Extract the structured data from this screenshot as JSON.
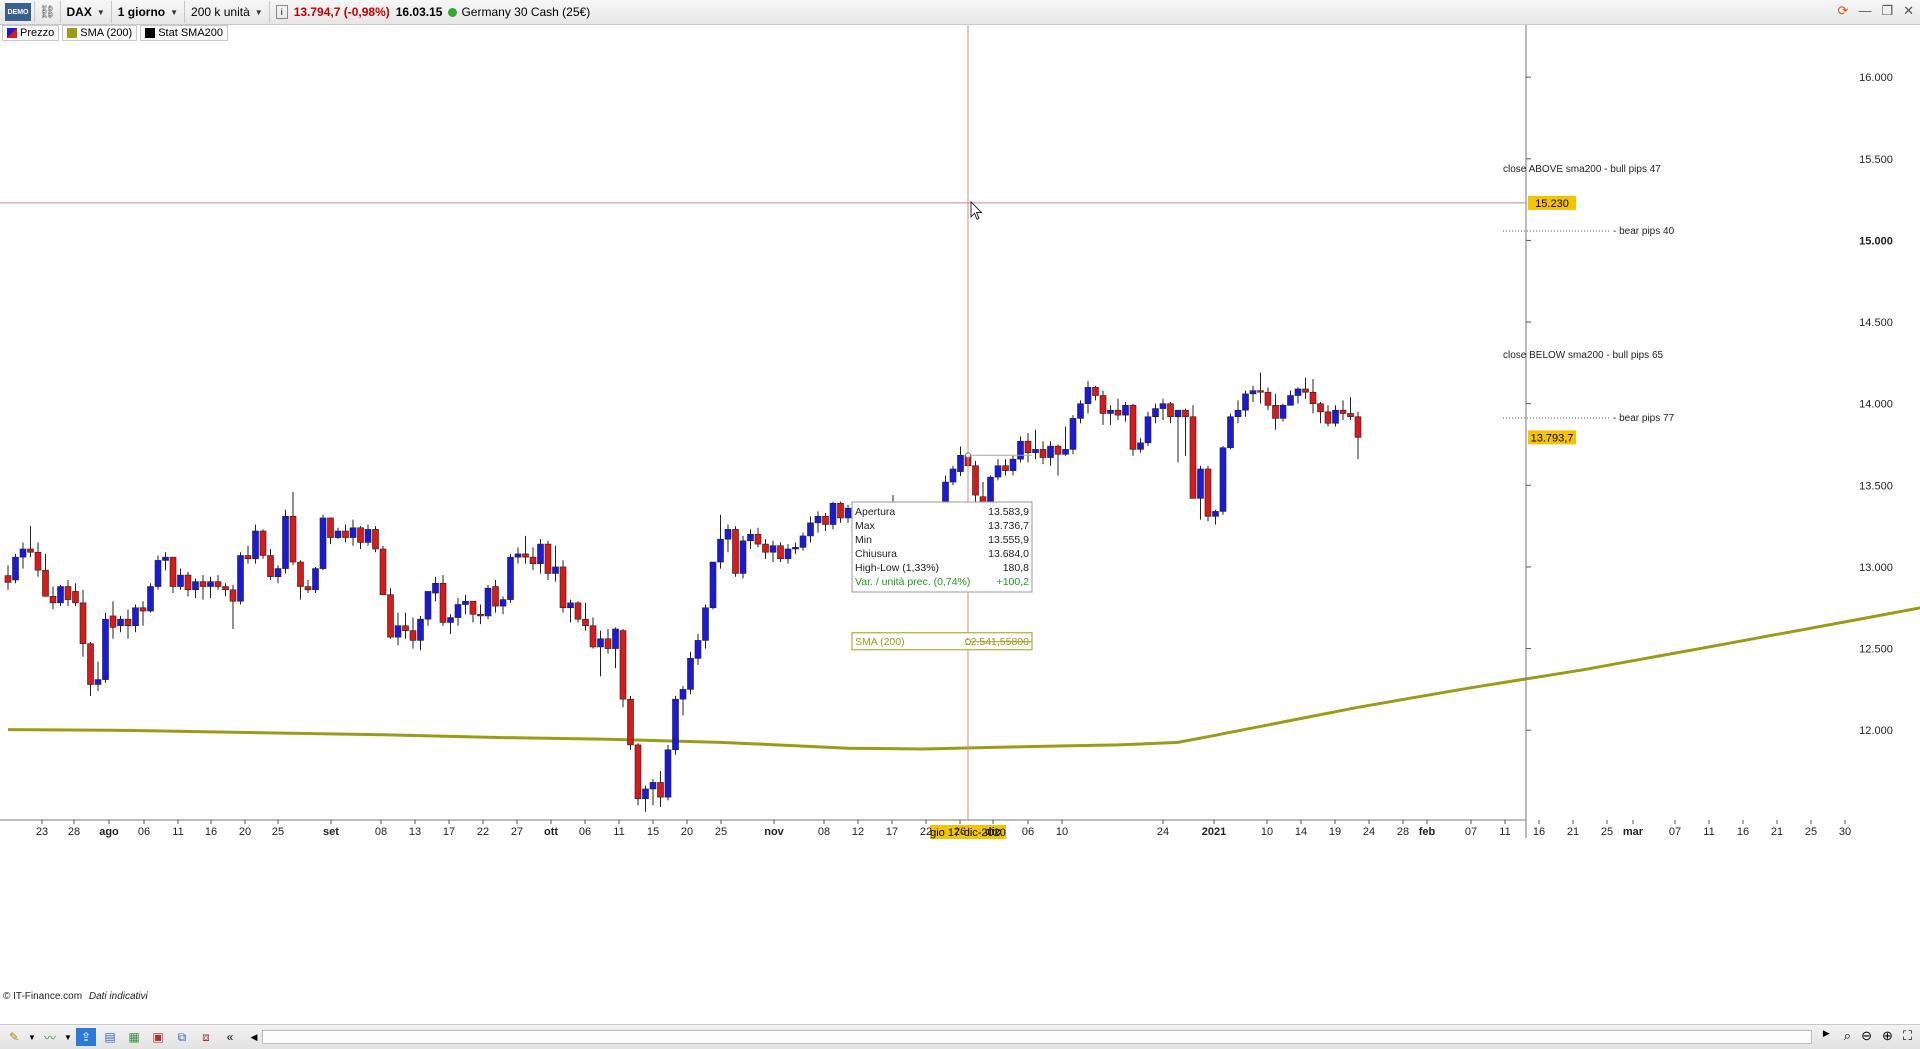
{
  "toolbar": {
    "logo": "DEMO",
    "symbol": "DAX",
    "timeframe": "1 giorno",
    "units": "200 k unità",
    "info_icon": "info-icon",
    "price": "13.794,7 (-0,98%)",
    "time": "16.03.15",
    "instrument": "Germany 30 Cash (25€)"
  },
  "legend": {
    "price": {
      "label": "Prezzo",
      "color": "#1b1bd6"
    },
    "sma": {
      "label": "SMA (200)",
      "color": "#9b9b1a"
    },
    "stat": {
      "label": "Stat SMA200",
      "color": "#000000"
    }
  },
  "tooltip": {
    "rows": [
      {
        "label": "Apertura",
        "value": "13.583,9"
      },
      {
        "label": "Max",
        "value": "13.736,7"
      },
      {
        "label": "Min",
        "value": "13.555,9"
      },
      {
        "label": "Chiusura",
        "value": "13.684,0"
      },
      {
        "label": "High-Low (1,33%)",
        "value": "180,8"
      },
      {
        "label": "Var. / unità prec. (0,74%)",
        "value": "+100,2"
      }
    ]
  },
  "sma_tooltip": {
    "label": "SMA (200)",
    "value": "12.541,55800"
  },
  "annotations": [
    {
      "text": "close ABOVE sma200  - bull pips 47"
    },
    {
      "text": "- bear pips 40"
    },
    {
      "text": "close BELOW sma200 - bull  pips 65"
    },
    {
      "text": "- bear pips 77"
    }
  ],
  "crosshair": {
    "price_label": "15.230",
    "date_label": "gio 17-dic-2020"
  },
  "last_price_label": "13.793,7",
  "footer": {
    "copyright": "© IT-Finance.com",
    "note": "Dati indicativi"
  },
  "chart_data": {
    "type": "candlestick",
    "y_ticks": [
      "16.000",
      "15.500",
      "15.000",
      "14.500",
      "14.000",
      "13.500",
      "13.000",
      "12.500",
      "12.000"
    ],
    "y_tick_values": [
      16000,
      15500,
      15000,
      14500,
      14000,
      13500,
      13000,
      12500,
      12000
    ],
    "ylim": [
      11450,
      16350
    ],
    "x_labels": [
      "23",
      "28",
      "ago",
      "06",
      "11",
      "16",
      "20",
      "25",
      "set",
      "08",
      "13",
      "17",
      "22",
      "27",
      "ott",
      "06",
      "11",
      "15",
      "20",
      "25",
      "nov",
      "08",
      "12",
      "17",
      "22",
      "26",
      "dic",
      "06",
      "10",
      "24",
      "2021",
      "10",
      "14",
      "19",
      "24",
      "28",
      "feb",
      "07",
      "11",
      "16",
      "21",
      "25",
      "mar",
      "07",
      "11",
      "16",
      "21",
      "25",
      "30"
    ],
    "bold_x_labels": [
      "ago",
      "set",
      "ott",
      "nov",
      "dic",
      "2021",
      "feb",
      "mar"
    ],
    "candles": [
      [
        12947,
        13010,
        12860,
        12905
      ],
      [
        12920,
        13080,
        12900,
        13060
      ],
      [
        13060,
        13150,
        12990,
        13110
      ],
      [
        13110,
        13250,
        13060,
        13090
      ],
      [
        13090,
        13150,
        12940,
        12980
      ],
      [
        12980,
        13080,
        12820,
        12820
      ],
      [
        12820,
        12880,
        12740,
        12780
      ],
      [
        12780,
        12890,
        12760,
        12880
      ],
      [
        12880,
        12920,
        12760,
        12800
      ],
      [
        12850,
        12900,
        12760,
        12780
      ],
      [
        12780,
        12860,
        12450,
        12530
      ],
      [
        12530,
        12540,
        12210,
        12280
      ],
      [
        12280,
        12420,
        12240,
        12310
      ],
      [
        12310,
        12720,
        12290,
        12680
      ],
      [
        12700,
        12790,
        12560,
        12630
      ],
      [
        12640,
        12700,
        12600,
        12680
      ],
      [
        12680,
        12740,
        12560,
        12640
      ],
      [
        12640,
        12770,
        12600,
        12750
      ],
      [
        12750,
        12790,
        12640,
        12730
      ],
      [
        12730,
        12900,
        12720,
        12880
      ],
      [
        12880,
        13070,
        12860,
        13040
      ],
      [
        13040,
        13090,
        12980,
        13060
      ],
      [
        13060,
        13060,
        12840,
        12880
      ],
      [
        12880,
        12990,
        12860,
        12950
      ],
      [
        12950,
        12970,
        12820,
        12860
      ],
      [
        12860,
        12930,
        12810,
        12910
      ],
      [
        12910,
        12950,
        12800,
        12880
      ],
      [
        12880,
        12940,
        12810,
        12910
      ],
      [
        12910,
        12950,
        12860,
        12880
      ],
      [
        12880,
        12900,
        12820,
        12860
      ],
      [
        12860,
        12890,
        12620,
        12790
      ],
      [
        12790,
        13090,
        12770,
        13070
      ],
      [
        13070,
        13130,
        13020,
        13050
      ],
      [
        13050,
        13260,
        13020,
        13220
      ],
      [
        13220,
        13230,
        13050,
        13070
      ],
      [
        13070,
        13110,
        12920,
        12940
      ],
      [
        12940,
        13010,
        12900,
        12990
      ],
      [
        12990,
        13350,
        12960,
        13310
      ],
      [
        13310,
        13460,
        13010,
        13030
      ],
      [
        13030,
        13040,
        12800,
        12880
      ],
      [
        12880,
        12920,
        12840,
        12860
      ],
      [
        12860,
        13000,
        12840,
        12990
      ],
      [
        12990,
        13320,
        12980,
        13300
      ],
      [
        13300,
        13300,
        13140,
        13180
      ],
      [
        13180,
        13240,
        13170,
        13220
      ],
      [
        13220,
        13260,
        13150,
        13180
      ],
      [
        13180,
        13290,
        13130,
        13240
      ],
      [
        13240,
        13250,
        13110,
        13150
      ],
      [
        13150,
        13260,
        13130,
        13230
      ],
      [
        13230,
        13250,
        13090,
        13110
      ],
      [
        13110,
        13130,
        12840,
        12830
      ],
      [
        12830,
        12870,
        12560,
        12570
      ],
      [
        12570,
        12720,
        12520,
        12640
      ],
      [
        12640,
        12720,
        12560,
        12610
      ],
      [
        12610,
        12690,
        12500,
        12550
      ],
      [
        12550,
        12700,
        12490,
        12680
      ],
      [
        12680,
        12850,
        12640,
        12850
      ],
      [
        12840,
        12940,
        12790,
        12900
      ],
      [
        12900,
        12950,
        12640,
        12660
      ],
      [
        12660,
        12710,
        12590,
        12690
      ],
      [
        12690,
        12810,
        12640,
        12770
      ],
      [
        12770,
        12830,
        12710,
        12790
      ],
      [
        12790,
        12780,
        12660,
        12710
      ],
      [
        12710,
        12770,
        12650,
        12700
      ],
      [
        12700,
        12890,
        12680,
        12870
      ],
      [
        12880,
        12920,
        12720,
        12760
      ],
      [
        12760,
        12820,
        12710,
        12800
      ],
      [
        12800,
        13080,
        12780,
        13060
      ],
      [
        13060,
        13120,
        13020,
        13080
      ],
      [
        13080,
        13190,
        13020,
        13060
      ],
      [
        13060,
        13120,
        12980,
        13020
      ],
      [
        13020,
        13170,
        12960,
        13140
      ],
      [
        13140,
        13160,
        12920,
        12960
      ],
      [
        12960,
        13130,
        12910,
        13000
      ],
      [
        13000,
        13040,
        12720,
        12750
      ],
      [
        12750,
        12800,
        12660,
        12780
      ],
      [
        12780,
        12790,
        12660,
        12680
      ],
      [
        12680,
        12780,
        12610,
        12640
      ],
      [
        12640,
        12690,
        12500,
        12510
      ],
      [
        12510,
        12610,
        12330,
        12560
      ],
      [
        12560,
        12620,
        12470,
        12500
      ],
      [
        12500,
        12630,
        12380,
        12620
      ],
      [
        12610,
        12620,
        12140,
        12190
      ],
      [
        12190,
        12210,
        11880,
        11910
      ],
      [
        11910,
        11920,
        11540,
        11580
      ],
      [
        11580,
        11660,
        11500,
        11640
      ],
      [
        11640,
        11700,
        11540,
        11680
      ],
      [
        11680,
        11750,
        11530,
        11590
      ],
      [
        11590,
        11910,
        11570,
        11880
      ],
      [
        11880,
        12210,
        11850,
        12190
      ],
      [
        12190,
        12270,
        12090,
        12250
      ],
      [
        12250,
        12480,
        12220,
        12440
      ],
      [
        12440,
        12590,
        12400,
        12550
      ],
      [
        12550,
        12770,
        12500,
        12750
      ],
      [
        12750,
        13030,
        12740,
        13030
      ],
      [
        13030,
        13320,
        12990,
        13170
      ],
      [
        13170,
        13260,
        13090,
        13230
      ],
      [
        13230,
        13250,
        12940,
        12960
      ],
      [
        12960,
        13190,
        12930,
        13160
      ],
      [
        13160,
        13230,
        13110,
        13200
      ],
      [
        13200,
        13240,
        13120,
        13140
      ],
      [
        13140,
        13170,
        13050,
        13090
      ],
      [
        13090,
        13160,
        13030,
        13130
      ],
      [
        13130,
        13150,
        13030,
        13050
      ],
      [
        13050,
        13140,
        13020,
        13110
      ],
      [
        13110,
        13150,
        13080,
        13120
      ],
      [
        13120,
        13210,
        13100,
        13190
      ],
      [
        13190,
        13310,
        13150,
        13270
      ],
      [
        13270,
        13340,
        13210,
        13310
      ],
      [
        13310,
        13330,
        13220,
        13260
      ],
      [
        13260,
        13400,
        13230,
        13390
      ],
      [
        13390,
        13400,
        13270,
        13300
      ],
      [
        13300,
        13380,
        13270,
        13360
      ],
      [
        13360,
        13380,
        13240,
        13270
      ],
      [
        13270,
        13330,
        13190,
        13230
      ],
      [
        13230,
        13270,
        13180,
        13200
      ],
      [
        13200,
        13290,
        13180,
        13260
      ],
      [
        13260,
        13280,
        13220,
        13250
      ],
      [
        13250,
        13440,
        13180,
        13300
      ],
      [
        13300,
        13310,
        13200,
        13230
      ],
      [
        13230,
        13250,
        13080,
        13170
      ],
      [
        13170,
        13230,
        13120,
        13210
      ],
      [
        13210,
        13230,
        13150,
        13170
      ],
      [
        13170,
        13370,
        13150,
        13360
      ],
      [
        13360,
        13380,
        13340,
        13360
      ],
      [
        13360,
        13560,
        13340,
        13520
      ],
      [
        13520,
        13620,
        13500,
        13600
      ],
      [
        13583.9,
        13736.7,
        13555.9,
        13684.0
      ],
      [
        13684,
        13720,
        13600,
        13620
      ],
      [
        13620,
        13650,
        13050,
        13440
      ],
      [
        13430,
        13520,
        13180,
        13370
      ],
      [
        13370,
        13560,
        13310,
        13550
      ],
      [
        13550,
        13660,
        13530,
        13620
      ],
      [
        13620,
        13660,
        13560,
        13590
      ],
      [
        13590,
        13680,
        13560,
        13660
      ],
      [
        13660,
        13800,
        13640,
        13770
      ],
      [
        13770,
        13820,
        13640,
        13700
      ],
      [
        13700,
        13840,
        13660,
        13720
      ],
      [
        13720,
        13770,
        13630,
        13670
      ],
      [
        13670,
        13770,
        13620,
        13740
      ],
      [
        13740,
        13750,
        13560,
        13690
      ],
      [
        13690,
        13860,
        13680,
        13720
      ],
      [
        13720,
        13930,
        13690,
        13910
      ],
      [
        13910,
        14020,
        13880,
        14000
      ],
      [
        14000,
        14140,
        13940,
        14100
      ],
      [
        14100,
        14110,
        14020,
        14050
      ],
      [
        14050,
        14080,
        13870,
        13940
      ],
      [
        13940,
        13990,
        13870,
        13960
      ],
      [
        13960,
        14030,
        13900,
        13930
      ],
      [
        13930,
        14010,
        13890,
        13990
      ],
      [
        13990,
        14000,
        13680,
        13720
      ],
      [
        13720,
        13790,
        13700,
        13760
      ],
      [
        13760,
        13950,
        13740,
        13920
      ],
      [
        13920,
        14000,
        13880,
        13970
      ],
      [
        13970,
        14030,
        13900,
        14000
      ],
      [
        14000,
        14010,
        13880,
        13920
      ],
      [
        13920,
        13950,
        13640,
        13960
      ],
      [
        13960,
        13970,
        13680,
        13920
      ],
      [
        13920,
        13990,
        13550,
        13420
      ],
      [
        13420,
        13620,
        13290,
        13600
      ],
      [
        13600,
        13620,
        13280,
        13310
      ],
      [
        13310,
        13350,
        13260,
        13340
      ],
      [
        13340,
        13740,
        13320,
        13730
      ],
      [
        13730,
        13940,
        13720,
        13920
      ],
      [
        13920,
        14020,
        13880,
        13960
      ],
      [
        13960,
        14080,
        13920,
        14060
      ],
      [
        14060,
        14110,
        14010,
        14080
      ],
      [
        14080,
        14190,
        14000,
        14070
      ],
      [
        14070,
        14100,
        13960,
        13990
      ],
      [
        13990,
        14060,
        13840,
        13910
      ],
      [
        13910,
        14000,
        13890,
        13990
      ],
      [
        13990,
        14080,
        13990,
        14050
      ],
      [
        14050,
        14100,
        14000,
        14090
      ],
      [
        14090,
        14160,
        14030,
        14070
      ],
      [
        14070,
        14150,
        13940,
        14000
      ],
      [
        14000,
        14010,
        13880,
        13950
      ],
      [
        13950,
        13990,
        13860,
        13880
      ],
      [
        13880,
        13990,
        13860,
        13960
      ],
      [
        13960,
        14020,
        13900,
        13940
      ],
      [
        13940,
        14040,
        13900,
        13920
      ],
      [
        13920,
        13950,
        13660,
        13793.7
      ]
    ],
    "sma": [
      [
        0,
        12004
      ],
      [
        14,
        12000
      ],
      [
        30,
        11988
      ],
      [
        50,
        11972
      ],
      [
        66,
        11955
      ],
      [
        80,
        11945
      ],
      [
        95,
        11925
      ],
      [
        105,
        11905
      ],
      [
        112,
        11890
      ],
      [
        122,
        11885
      ],
      [
        132,
        11895
      ],
      [
        140,
        11903
      ],
      [
        148,
        11910
      ],
      [
        156,
        11925
      ],
      [
        160,
        11960
      ],
      [
        170,
        12050
      ],
      [
        180,
        12140
      ],
      [
        195,
        12260
      ],
      [
        210,
        12370
      ],
      [
        228,
        12520
      ],
      [
        248,
        12690
      ],
      [
        262,
        12810
      ],
      [
        280,
        12920
      ],
      [
        300,
        12980
      ],
      [
        320,
        13050
      ],
      [
        336,
        13090
      ],
      [
        350,
        13140
      ],
      [
        365,
        13180
      ],
      [
        380,
        13195
      ],
      [
        390,
        13220
      ],
      [
        400,
        13250
      ],
      [
        412,
        13290
      ],
      [
        420,
        13320
      ]
    ]
  }
}
